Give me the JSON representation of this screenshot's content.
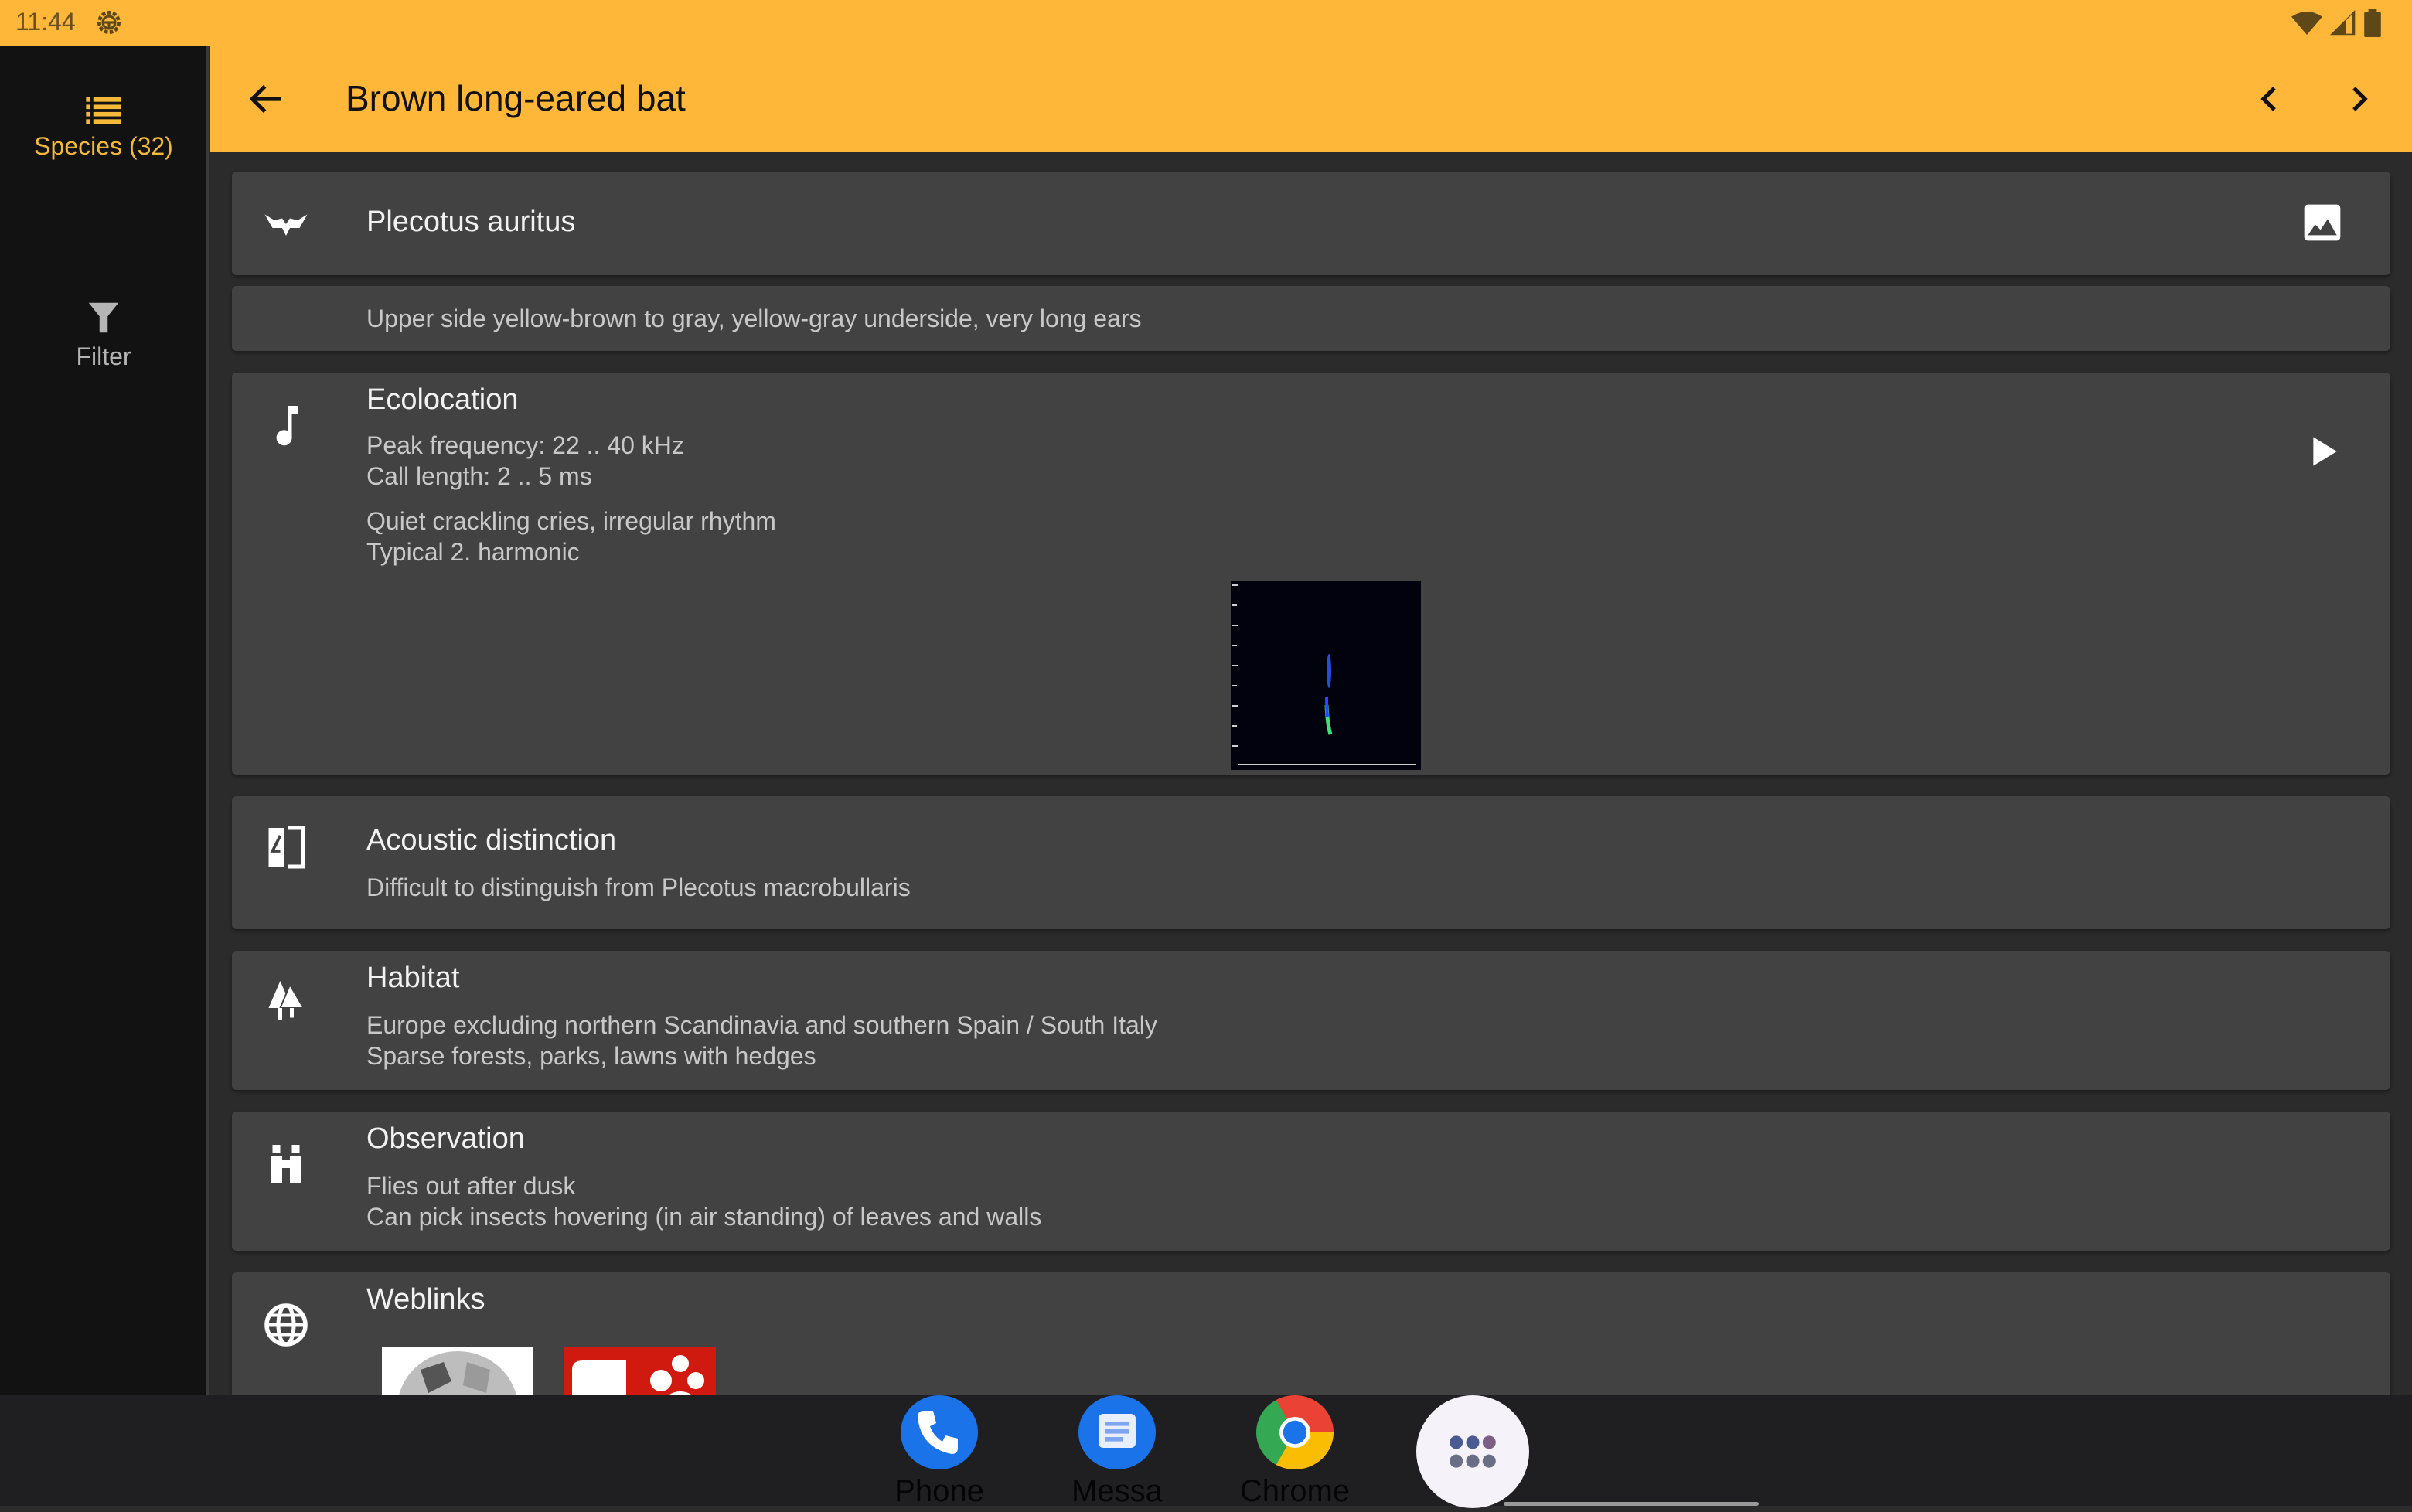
{
  "status_bar": {
    "time": "11:44",
    "icons": [
      "settings-gear-icon",
      "wifi-icon",
      "signal-icon",
      "battery-icon"
    ]
  },
  "sidebar": {
    "items": [
      {
        "label": "Species (32)",
        "icon": "list-icon",
        "active": true
      },
      {
        "label": "Filter",
        "icon": "filter-icon",
        "active": false
      }
    ]
  },
  "app_bar": {
    "title": "Brown long-eared bat",
    "back_icon": "arrow-left-icon",
    "prev_icon": "chevron-left-icon",
    "next_icon": "chevron-right-icon"
  },
  "species": {
    "scientific_name": "Plecotus auritus",
    "description": "Upper side yellow-brown to gray, yellow-gray underside, very long ears"
  },
  "echolocation": {
    "heading": "Ecolocation",
    "peak_frequency": "Peak frequency: 22 .. 40 kHz",
    "call_length": "Call length: 2 .. 5 ms",
    "note1": "Quiet crackling cries, irregular rhythm",
    "note2": "Typical 2. harmonic"
  },
  "acoustic": {
    "heading": "Acoustic distinction",
    "text": "Difficult to distinguish from Plecotus macrobullaris"
  },
  "habitat": {
    "heading": "Habitat",
    "line1": "Europe excluding northern Scandinavia and southern Spain / South Italy",
    "line2": "Sparse forests, parks, lawns with hedges"
  },
  "observation": {
    "heading": "Observation",
    "line1": "Flies out after dusk",
    "line2": "Can pick insects hovering (in air standing) of leaves and walls"
  },
  "weblinks": {
    "heading": "Weblinks",
    "links": [
      "wikipedia-logo",
      "red-paw-logo"
    ]
  },
  "dock": {
    "apps": [
      {
        "label": "Phone"
      },
      {
        "label": "Messa"
      },
      {
        "label": "Chrome"
      },
      {
        "label": ""
      }
    ]
  },
  "colors": {
    "accent": "#FFB73A",
    "sidebar_active": "#F5B93A",
    "card_bg": "#424242",
    "background": "#2b2b2b"
  }
}
